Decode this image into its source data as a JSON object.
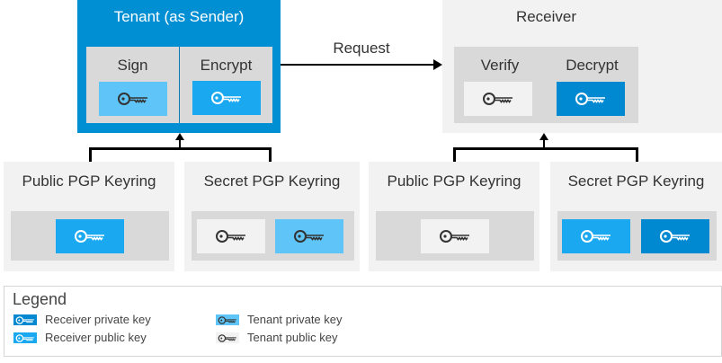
{
  "tenant": {
    "title": "Tenant (as Sender)",
    "sign": "Sign",
    "encrypt": "Encrypt"
  },
  "receiver": {
    "title": "Receiver",
    "verify": "Verify",
    "decrypt": "Decrypt"
  },
  "request_label": "Request",
  "keyrings": {
    "tenant_public": "Public PGP Keyring",
    "tenant_secret": "Secret PGP Keyring",
    "receiver_public": "Public PGP Keyring",
    "receiver_secret": "Secret PGP Keyring"
  },
  "legend": {
    "title": "Legend",
    "items": [
      "Receiver private key",
      "Receiver public key",
      "Tenant private key",
      "Tenant public key"
    ]
  },
  "colors": {
    "tenant_box": "#008fd3",
    "receiver_private": "#0088d1",
    "receiver_public": "#1aa9f0",
    "tenant_private": "#5fc4f7",
    "tenant_public": "#f2f2f2"
  }
}
